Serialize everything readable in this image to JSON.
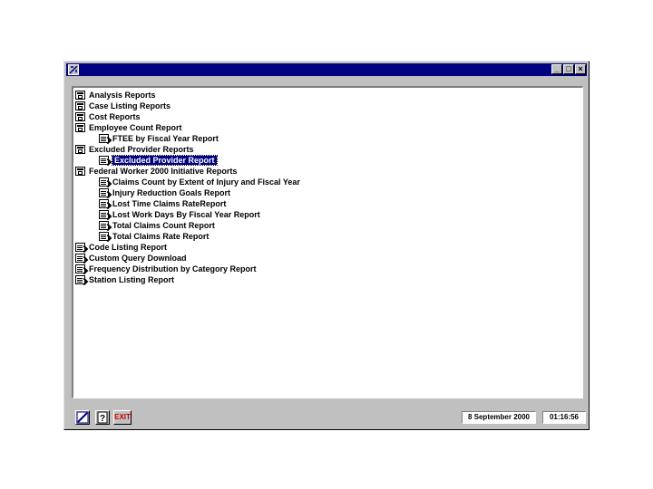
{
  "window": {
    "controls": {
      "minimize": "_",
      "maximize": "□",
      "close": "×"
    }
  },
  "tree": {
    "items": [
      {
        "label": "Analysis Reports",
        "type": "folder",
        "level": 0
      },
      {
        "label": "Case Listing Reports",
        "type": "folder",
        "level": 0
      },
      {
        "label": "Cost Reports",
        "type": "folder",
        "level": 0
      },
      {
        "label": "Employee Count Report",
        "type": "folder",
        "level": 0
      },
      {
        "label": "FTEE by Fiscal Year Report",
        "type": "report",
        "level": 1
      },
      {
        "label": "Excluded Provider Reports",
        "type": "folder",
        "level": 0
      },
      {
        "label": "Excluded Provider Report",
        "type": "report",
        "level": 1,
        "selected": true
      },
      {
        "label": "Federal Worker 2000 Initiative Reports",
        "type": "folder",
        "level": 0
      },
      {
        "label": "Claims Count by Extent of Injury and Fiscal Year",
        "type": "report",
        "level": 1
      },
      {
        "label": "Injury Reduction Goals Report",
        "type": "report",
        "level": 1
      },
      {
        "label": "Lost Time Claims RateReport",
        "type": "report",
        "level": 1
      },
      {
        "label": "Lost Work Days By Fiscal Year Report",
        "type": "report",
        "level": 1
      },
      {
        "label": "Total Claims Count Report",
        "type": "report",
        "level": 1
      },
      {
        "label": "Total Claims Rate Report",
        "type": "report",
        "level": 1
      },
      {
        "label": "Code Listing Report",
        "type": "report",
        "level": 0
      },
      {
        "label": "Custom Query Download",
        "type": "report",
        "level": 0
      },
      {
        "label": "Frequency Distribution by Category Report",
        "type": "report",
        "level": 0
      },
      {
        "label": "Station Listing Report",
        "type": "report",
        "level": 0
      }
    ]
  },
  "statusbar": {
    "exit_label": "EXIT",
    "date": "8 September 2000",
    "time": "01:16:56"
  }
}
